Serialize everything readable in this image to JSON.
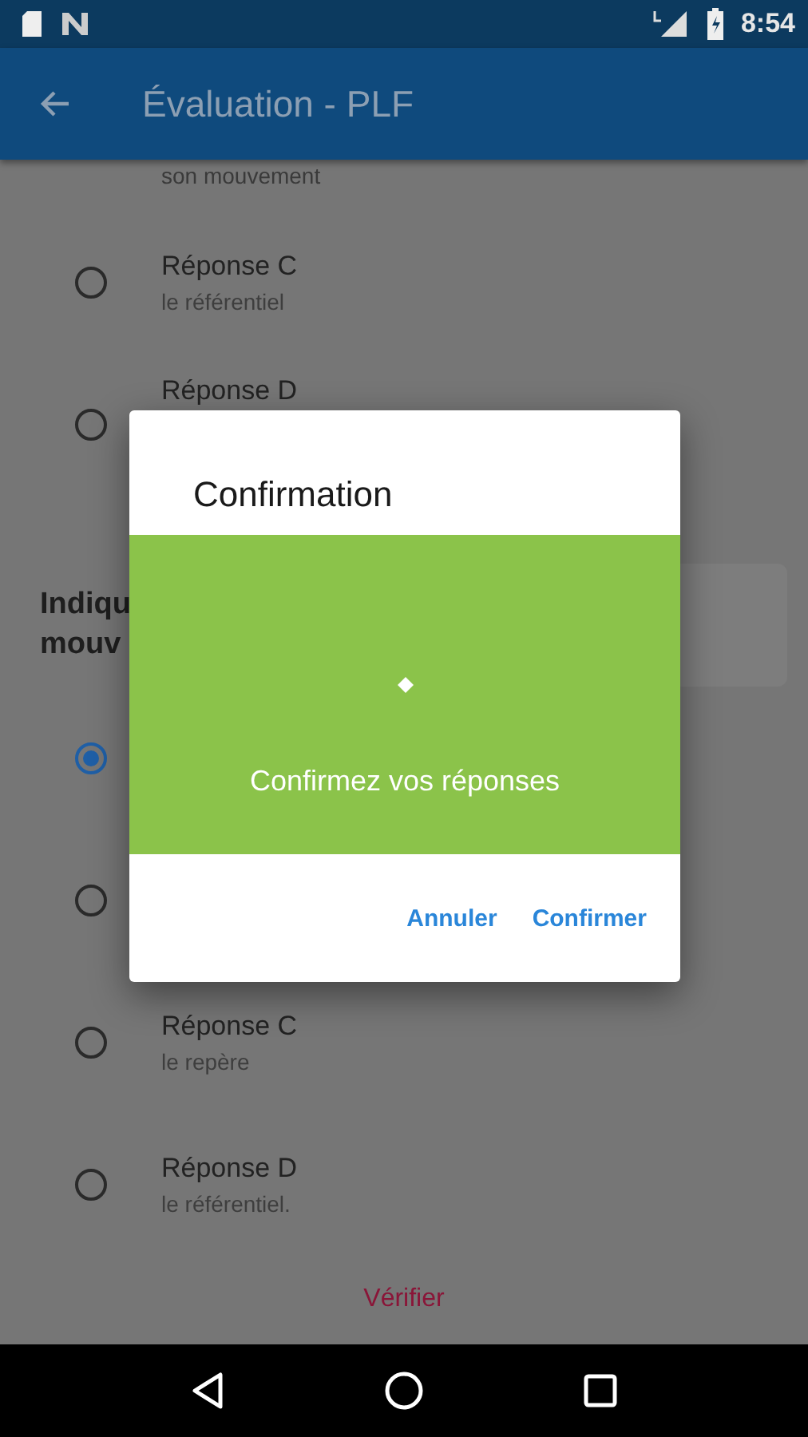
{
  "status_bar": {
    "time": "8:54"
  },
  "app_bar": {
    "title": "Évaluation - PLF"
  },
  "previous_question": {
    "options": [
      {
        "subtitle": "son mouvement"
      },
      {
        "label": "Réponse C",
        "subtitle": "le référentiel",
        "selected": false
      },
      {
        "label": "Réponse D",
        "selected": false
      }
    ]
  },
  "question": {
    "text_lines": [
      "Indiqu",
      "mouv"
    ],
    "options": [
      {
        "selected": true
      },
      {
        "selected": false
      },
      {
        "label": "Réponse C",
        "subtitle": "le repère",
        "selected": false
      },
      {
        "label": "Réponse D",
        "subtitle": "le référentiel.",
        "selected": false
      }
    ]
  },
  "verify_button": "Vérifier",
  "dialog": {
    "title": "Confirmation",
    "message": "Confirmez vos réponses",
    "buttons": [
      "Annuler",
      "Confirmer"
    ]
  }
}
